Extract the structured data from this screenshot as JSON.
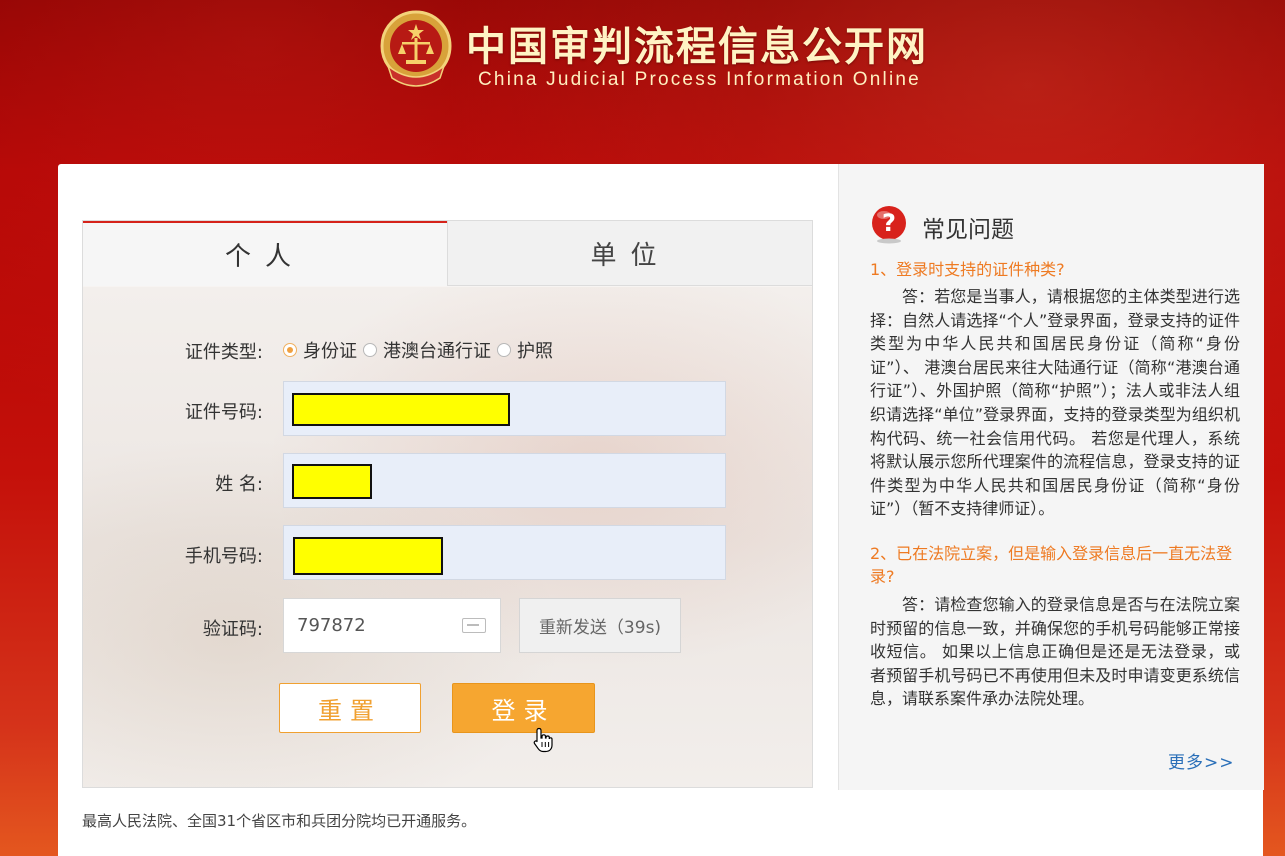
{
  "header": {
    "title_cn": "中国审判流程信息公开网",
    "title_en": "China Judicial Process Information Online"
  },
  "tabs": {
    "person": "个人",
    "unit": "单位"
  },
  "form": {
    "id_type_label": "证件类型:",
    "id_types": [
      "身份证",
      "港澳台通行证",
      "护照"
    ],
    "id_type_selected": "身份证",
    "id_number_label": "证件号码:",
    "name_label": "姓 名:",
    "phone_label": "手机号码:",
    "code_label": "验证码:",
    "code_value": "797872",
    "resend_label": "重新发送（39s)",
    "reset_label": "重置",
    "login_label": "登录"
  },
  "footer_note": "最高人民法院、全国31个省区市和兵团分院均已开通服务。",
  "faq": {
    "title": "常见问题",
    "q1": "1、登录时支持的证件种类?",
    "a1": "答：若您是当事人，请根据您的主体类型进行选择：自然人请选择“个人”登录界面，登录支持的证件类型为中华人民共和国居民身份证（简称“身份证”）、 港澳台居民来往大陆通行证（简称“港澳台通行证”）、外国护照（简称“护照”）；法人或非法人组织请选择“单位”登录界面，支持的登录类型为组织机构代码、统一社会信用代码。 若您是代理人，系统将默认展示您所代理案件的流程信息，登录支持的证件类型为中华人民共和国居民身份证（简称“身份证”）（暂不支持律师证）。",
    "q2": "2、已在法院立案，但是输入登录信息后一直无法登录?",
    "a2": "答：请检查您输入的登录信息是否与在法院立案时预留的信息一致，并确保您的手机号码能够正常接收短信。 如果以上信息正确但是还是无法登录，或者预留手机号码已不再使用但未及时申请变更系统信息，请联系案件承办法院处理。",
    "more": "更多>>"
  },
  "colors": {
    "accent_red": "#d5221a",
    "accent_orange": "#f6a630",
    "link_blue": "#2a6fb8",
    "faq_question": "#ee7a22"
  }
}
